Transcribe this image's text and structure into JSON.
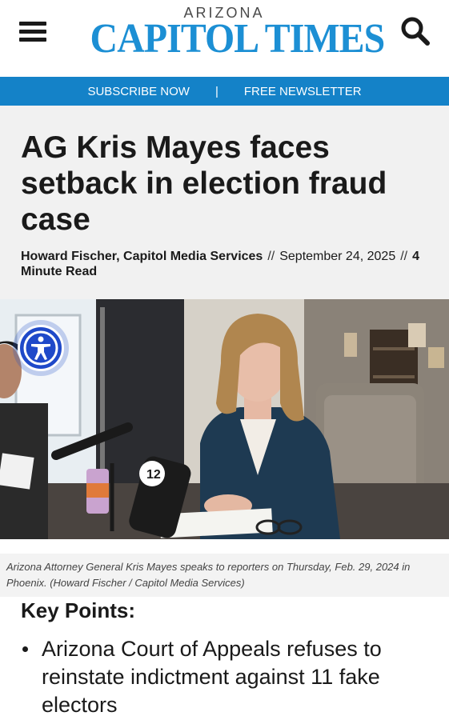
{
  "header": {
    "logo_top": "ARIZONA",
    "logo_main": "CAPITOL TIMES",
    "menu_icon": "hamburger-menu-icon",
    "search_icon": "search-icon",
    "logo_color": "#1c8fd4"
  },
  "subbar": {
    "subscribe": "SUBSCRIBE NOW",
    "separator": "|",
    "newsletter": "FREE NEWSLETTER",
    "color": "#1482c8"
  },
  "article": {
    "headline": "AG Kris Mayes faces setback in election fraud case",
    "author": "Howard Fischer, Capitol Media Services",
    "separator": "//",
    "date": "September 24, 2025",
    "read_time": "4 Minute Read"
  },
  "photo": {
    "accessibility_icon": "accessibility-icon",
    "caption": "Arizona Attorney General Kris Mayes speaks to reporters on Thursday, Feb. 29, 2024 in Phoenix. (Howard Fischer / Capitol Media Services)"
  },
  "key_points": {
    "title": "Key Points:",
    "items": [
      "Arizona Court of Appeals refuses to reinstate indictment against 11 fake electors"
    ]
  }
}
